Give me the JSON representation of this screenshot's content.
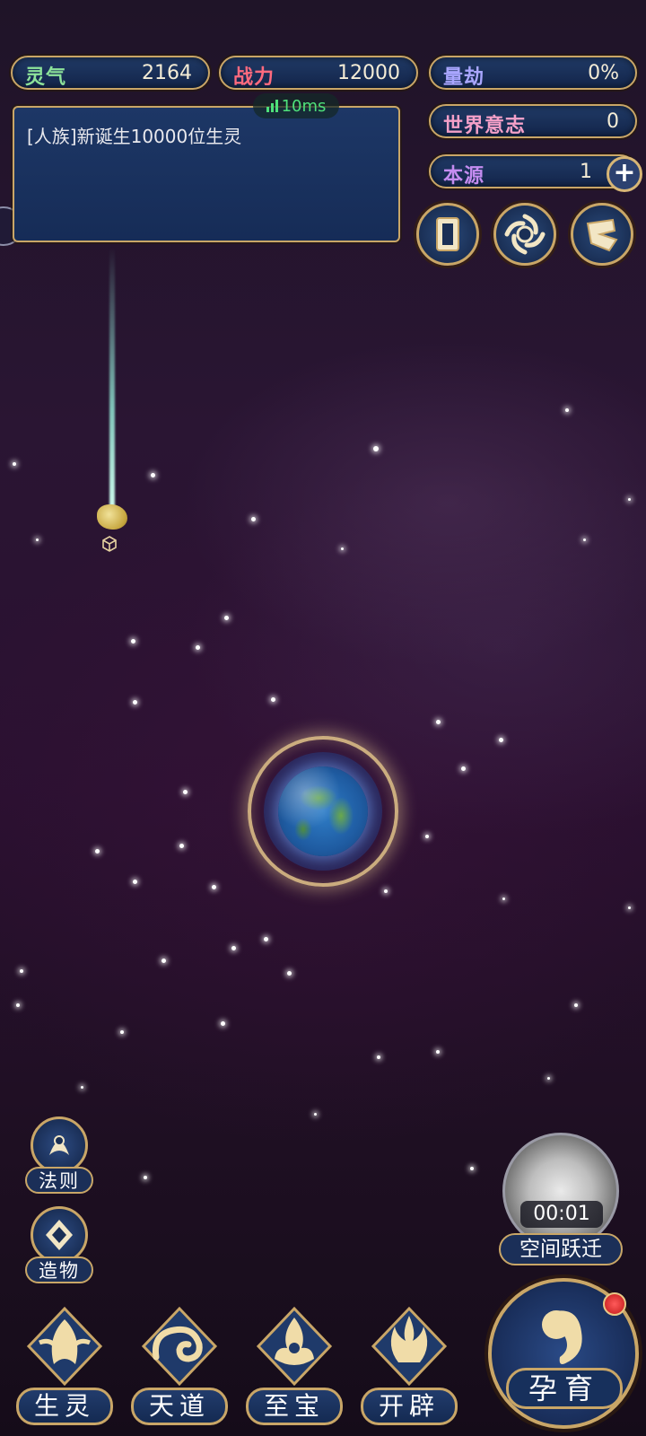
{
  "stats": {
    "lingqi": {
      "label": "灵气",
      "value": "2164"
    },
    "zhanli": {
      "label": "战力",
      "value": "12000"
    },
    "liangjie": {
      "label": "量劫",
      "value": "0%"
    },
    "world_will": {
      "label": "世界意志",
      "value": "0"
    },
    "origin": {
      "label": "本源",
      "value": "1"
    }
  },
  "network": {
    "ping": "10ms"
  },
  "chat": {
    "message": "[人族]新诞生10000位生灵"
  },
  "top_icons": [
    "card-icon",
    "vortex-icon",
    "scroll-icon"
  ],
  "side_buttons": [
    {
      "label": "法则",
      "icon": "law-icon"
    },
    {
      "label": "造物",
      "icon": "creation-icon"
    }
  ],
  "space_warp": {
    "timer": "00:01",
    "label": "空间跃迁"
  },
  "bottom_nav": [
    {
      "label": "生灵",
      "icon": "phoenix-icon"
    },
    {
      "label": "天道",
      "icon": "cloud-swirl-icon"
    },
    {
      "label": "至宝",
      "icon": "treasure-icon"
    },
    {
      "label": "开辟",
      "icon": "flame-icon"
    }
  ],
  "breed": {
    "label": "孕育",
    "icon": "fetus-icon",
    "has_notification": true
  },
  "colors": {
    "gold_border": "#c9a667",
    "panel_blue": "#1d3766",
    "ping_green": "#4ee07a",
    "notification_red": "#e02424"
  }
}
